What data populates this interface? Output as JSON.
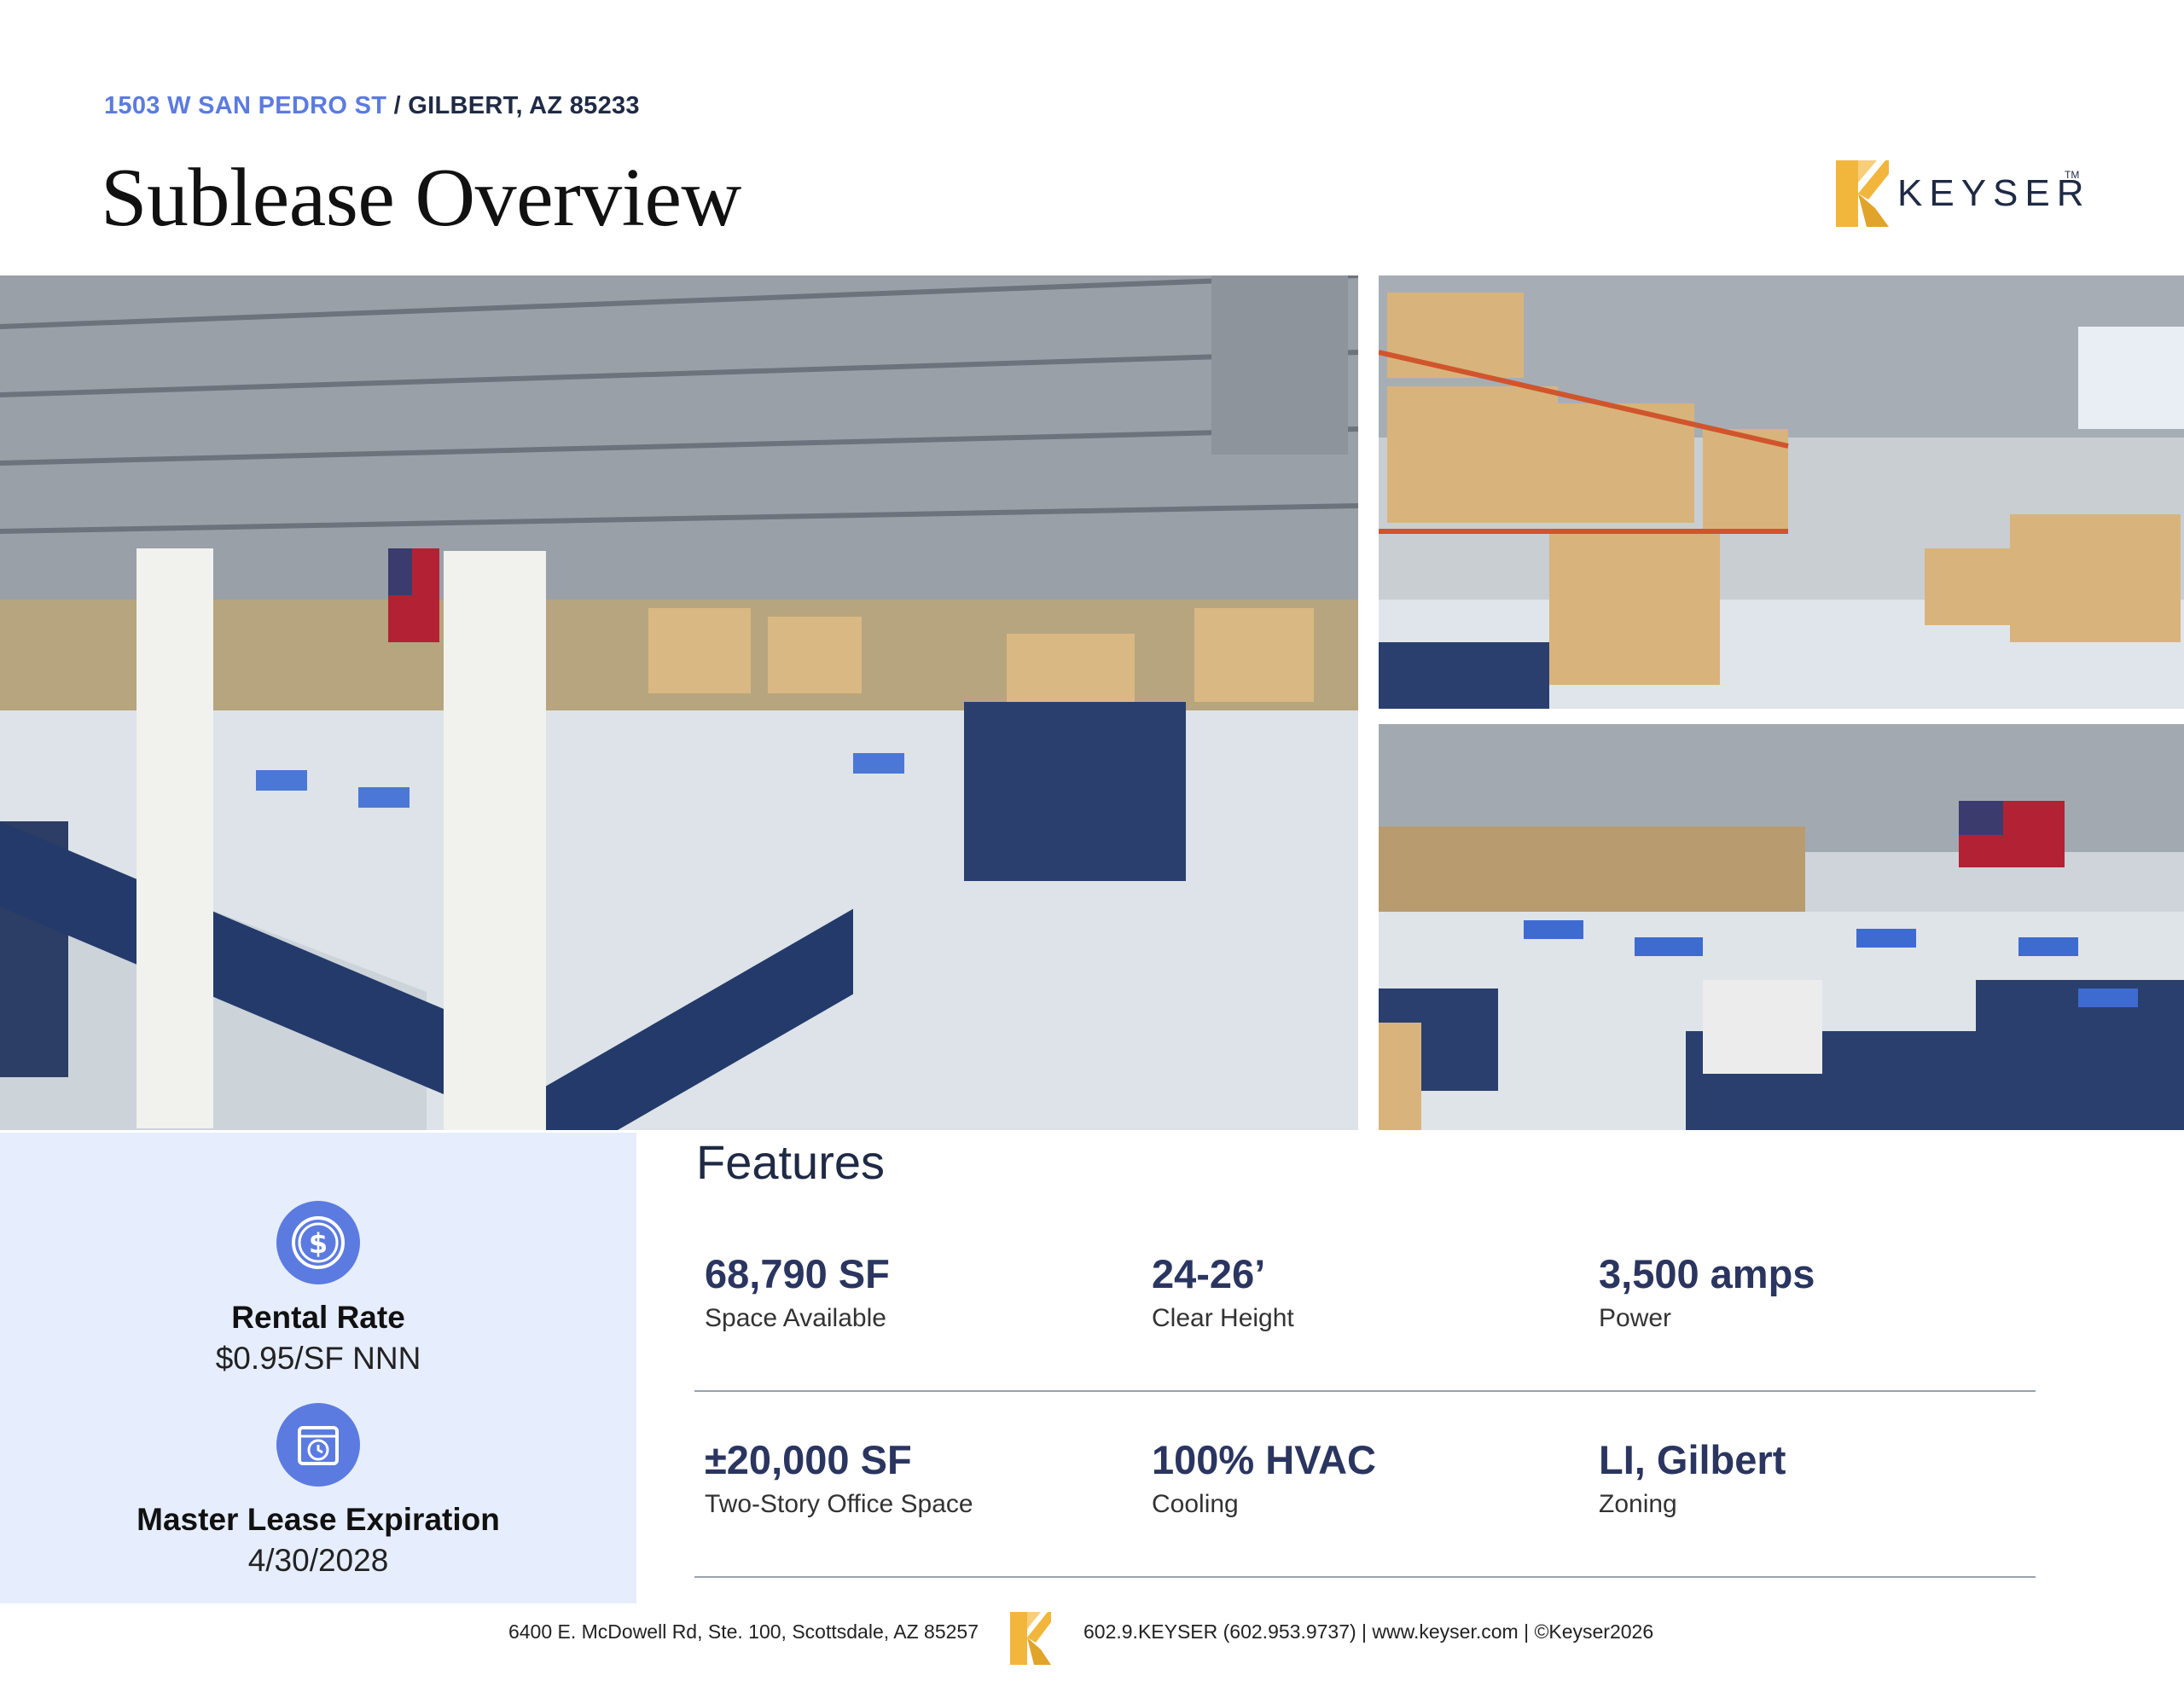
{
  "header": {
    "address_street": "1503 W SAN PEDRO ST",
    "address_city": " / GILBERT, AZ 85233",
    "title": "Sublease Overview"
  },
  "logo": {
    "brand": "KEYSER",
    "trademark": "TM",
    "icon": "keyser-k-logo-icon",
    "brand_color": "#f2b63c"
  },
  "photos": [
    {
      "name": "warehouse-manufacturing-floor-photo"
    },
    {
      "name": "warehouse-racking-aisle-photo"
    },
    {
      "name": "warehouse-workstations-flag-photo"
    }
  ],
  "highlights": {
    "rental_rate_label": "Rental Rate",
    "rental_rate_value": "$0.95/SF NNN",
    "rental_rate_icon": "dollar-icon",
    "lease_label": "Master Lease Expiration",
    "lease_value": "4/30/2028",
    "lease_icon": "calendar-clock-icon"
  },
  "features": {
    "title": "Features",
    "items": [
      {
        "value": "68,790 SF",
        "label": "Space Available"
      },
      {
        "value": "24-26’",
        "label": "Clear Height"
      },
      {
        "value": "3,500 amps",
        "label": "Power"
      },
      {
        "value": "±20,000 SF",
        "label": "Two-Story Office Space"
      },
      {
        "value": "100% HVAC",
        "label": "Cooling"
      },
      {
        "value": "LI, Gilbert",
        "label": "Zoning"
      }
    ]
  },
  "footer": {
    "address": "6400 E. McDowell Rd, Ste. 100, Scottsdale, AZ 85257",
    "contact": "602.9.KEYSER (602.953.9737)  |  www.keyser.com  |  ©Keyser2026"
  },
  "colors": {
    "accent": "#5b7be0",
    "panel": "#e6edfd",
    "navy": "#1f2a44",
    "gold": "#f2b63c"
  }
}
